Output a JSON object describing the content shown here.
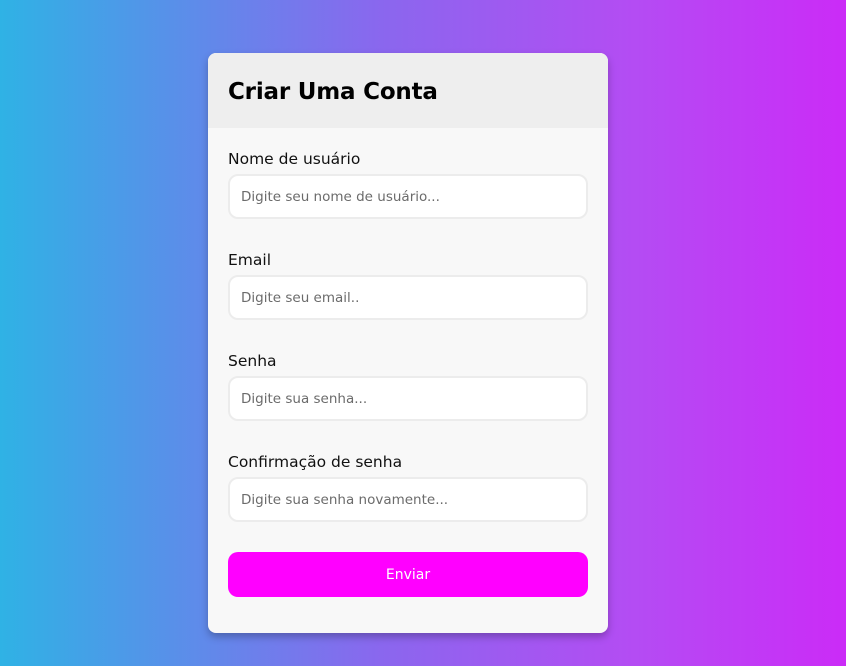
{
  "form": {
    "title": "Criar Uma Conta",
    "fields": [
      {
        "label": "Nome de usuário",
        "placeholder": "Digite seu nome de usuário...",
        "type": "text",
        "value": ""
      },
      {
        "label": "Email",
        "placeholder": "Digite seu email..",
        "type": "email",
        "value": ""
      },
      {
        "label": "Senha",
        "placeholder": "Digite sua senha...",
        "type": "password",
        "value": ""
      },
      {
        "label": "Confirmação de senha",
        "placeholder": "Digite sua senha novamente...",
        "type": "password",
        "value": ""
      }
    ],
    "submit_label": "Enviar"
  },
  "colors": {
    "background_gradient_start": "#2fb2e5",
    "background_gradient_end": "#cb2bf7",
    "header_background": "#eeeeee",
    "card_background": "#f8f8f8",
    "button_background": "#ff00ff",
    "button_text": "#ffffff"
  }
}
